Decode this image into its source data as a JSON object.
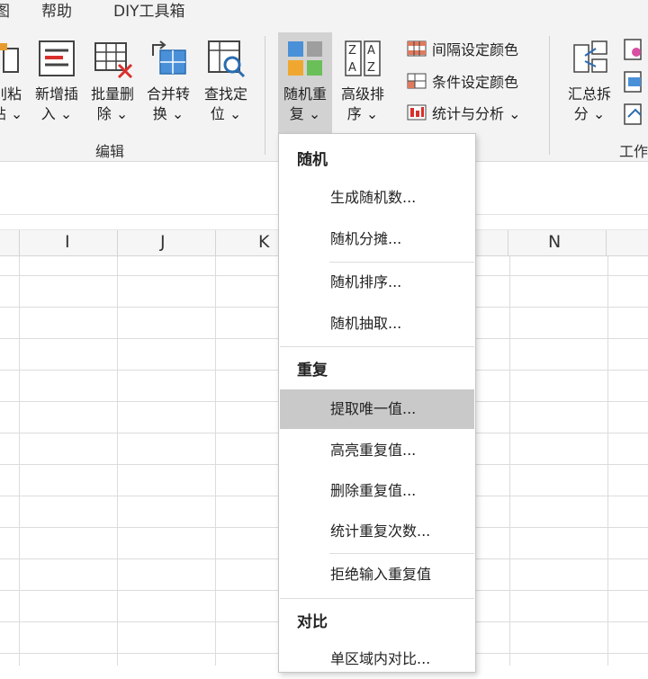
{
  "menu": {
    "tab_partial": "图",
    "tab_help": "帮助",
    "tab_diy": "DIY工具箱"
  },
  "ribbon": {
    "buttons": {
      "paste": [
        "刖粘",
        "贴 ⌄"
      ],
      "insert": [
        "新增插",
        "入 ⌄"
      ],
      "delete": [
        "批量删",
        "除 ⌄"
      ],
      "merge": [
        "合并转",
        "换 ⌄"
      ],
      "find": [
        "查找定",
        "位 ⌄"
      ],
      "random": [
        "随机重",
        "复 ⌄"
      ],
      "sort": [
        "高级排",
        "序 ⌄"
      ],
      "summary": [
        "汇总拆",
        "分 ⌄"
      ]
    },
    "small": {
      "interval_color": "间隔设定颜色",
      "cond_color": "条件设定颜色",
      "stats": "统计与分析 ⌄"
    },
    "group_edit": "编辑",
    "group_work": "工作"
  },
  "columns": [
    "I",
    "J",
    "K",
    "N"
  ],
  "dropdown": {
    "sections": {
      "random": "随机",
      "duplicate": "重复",
      "compare": "对比"
    },
    "items": {
      "gen_random": "生成随机数...",
      "random_split": "随机分摊...",
      "random_sort": "随机排序...",
      "random_pick": "随机抽取...",
      "extract_unique": "提取唯一值...",
      "highlight_dup": "高亮重复值...",
      "delete_dup": "删除重复值...",
      "count_dup": "统计重复次数...",
      "reject_dup": "拒绝输入重复值",
      "compare_single": "单区域内对比..."
    }
  }
}
